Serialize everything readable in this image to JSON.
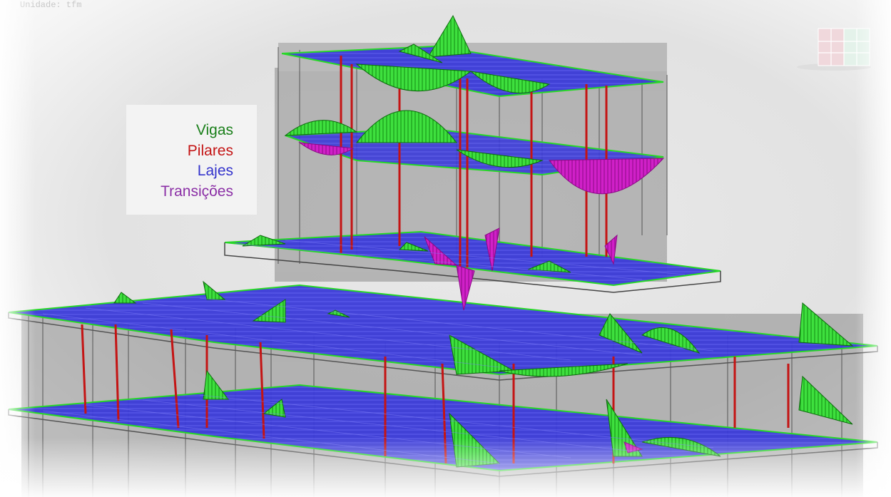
{
  "viewport": {
    "units_label": "Unidade: tfm"
  },
  "legend": {
    "items": [
      {
        "label": "Vigas",
        "color": "#1a7f1a"
      },
      {
        "label": "Pilares",
        "color": "#c41414"
      },
      {
        "label": "Lajes",
        "color": "#3333cc"
      },
      {
        "label": "Transições",
        "color": "#8b2fa6"
      }
    ]
  },
  "colors": {
    "beams": "#27d827",
    "beam_edge": "#0d6b0d",
    "columns": "#c41414",
    "slabs": "#3b3bd8",
    "transitions": "#d020c8",
    "structure": "#6e6e6e"
  },
  "view_cube": {
    "icon": "view-cube-icon"
  }
}
